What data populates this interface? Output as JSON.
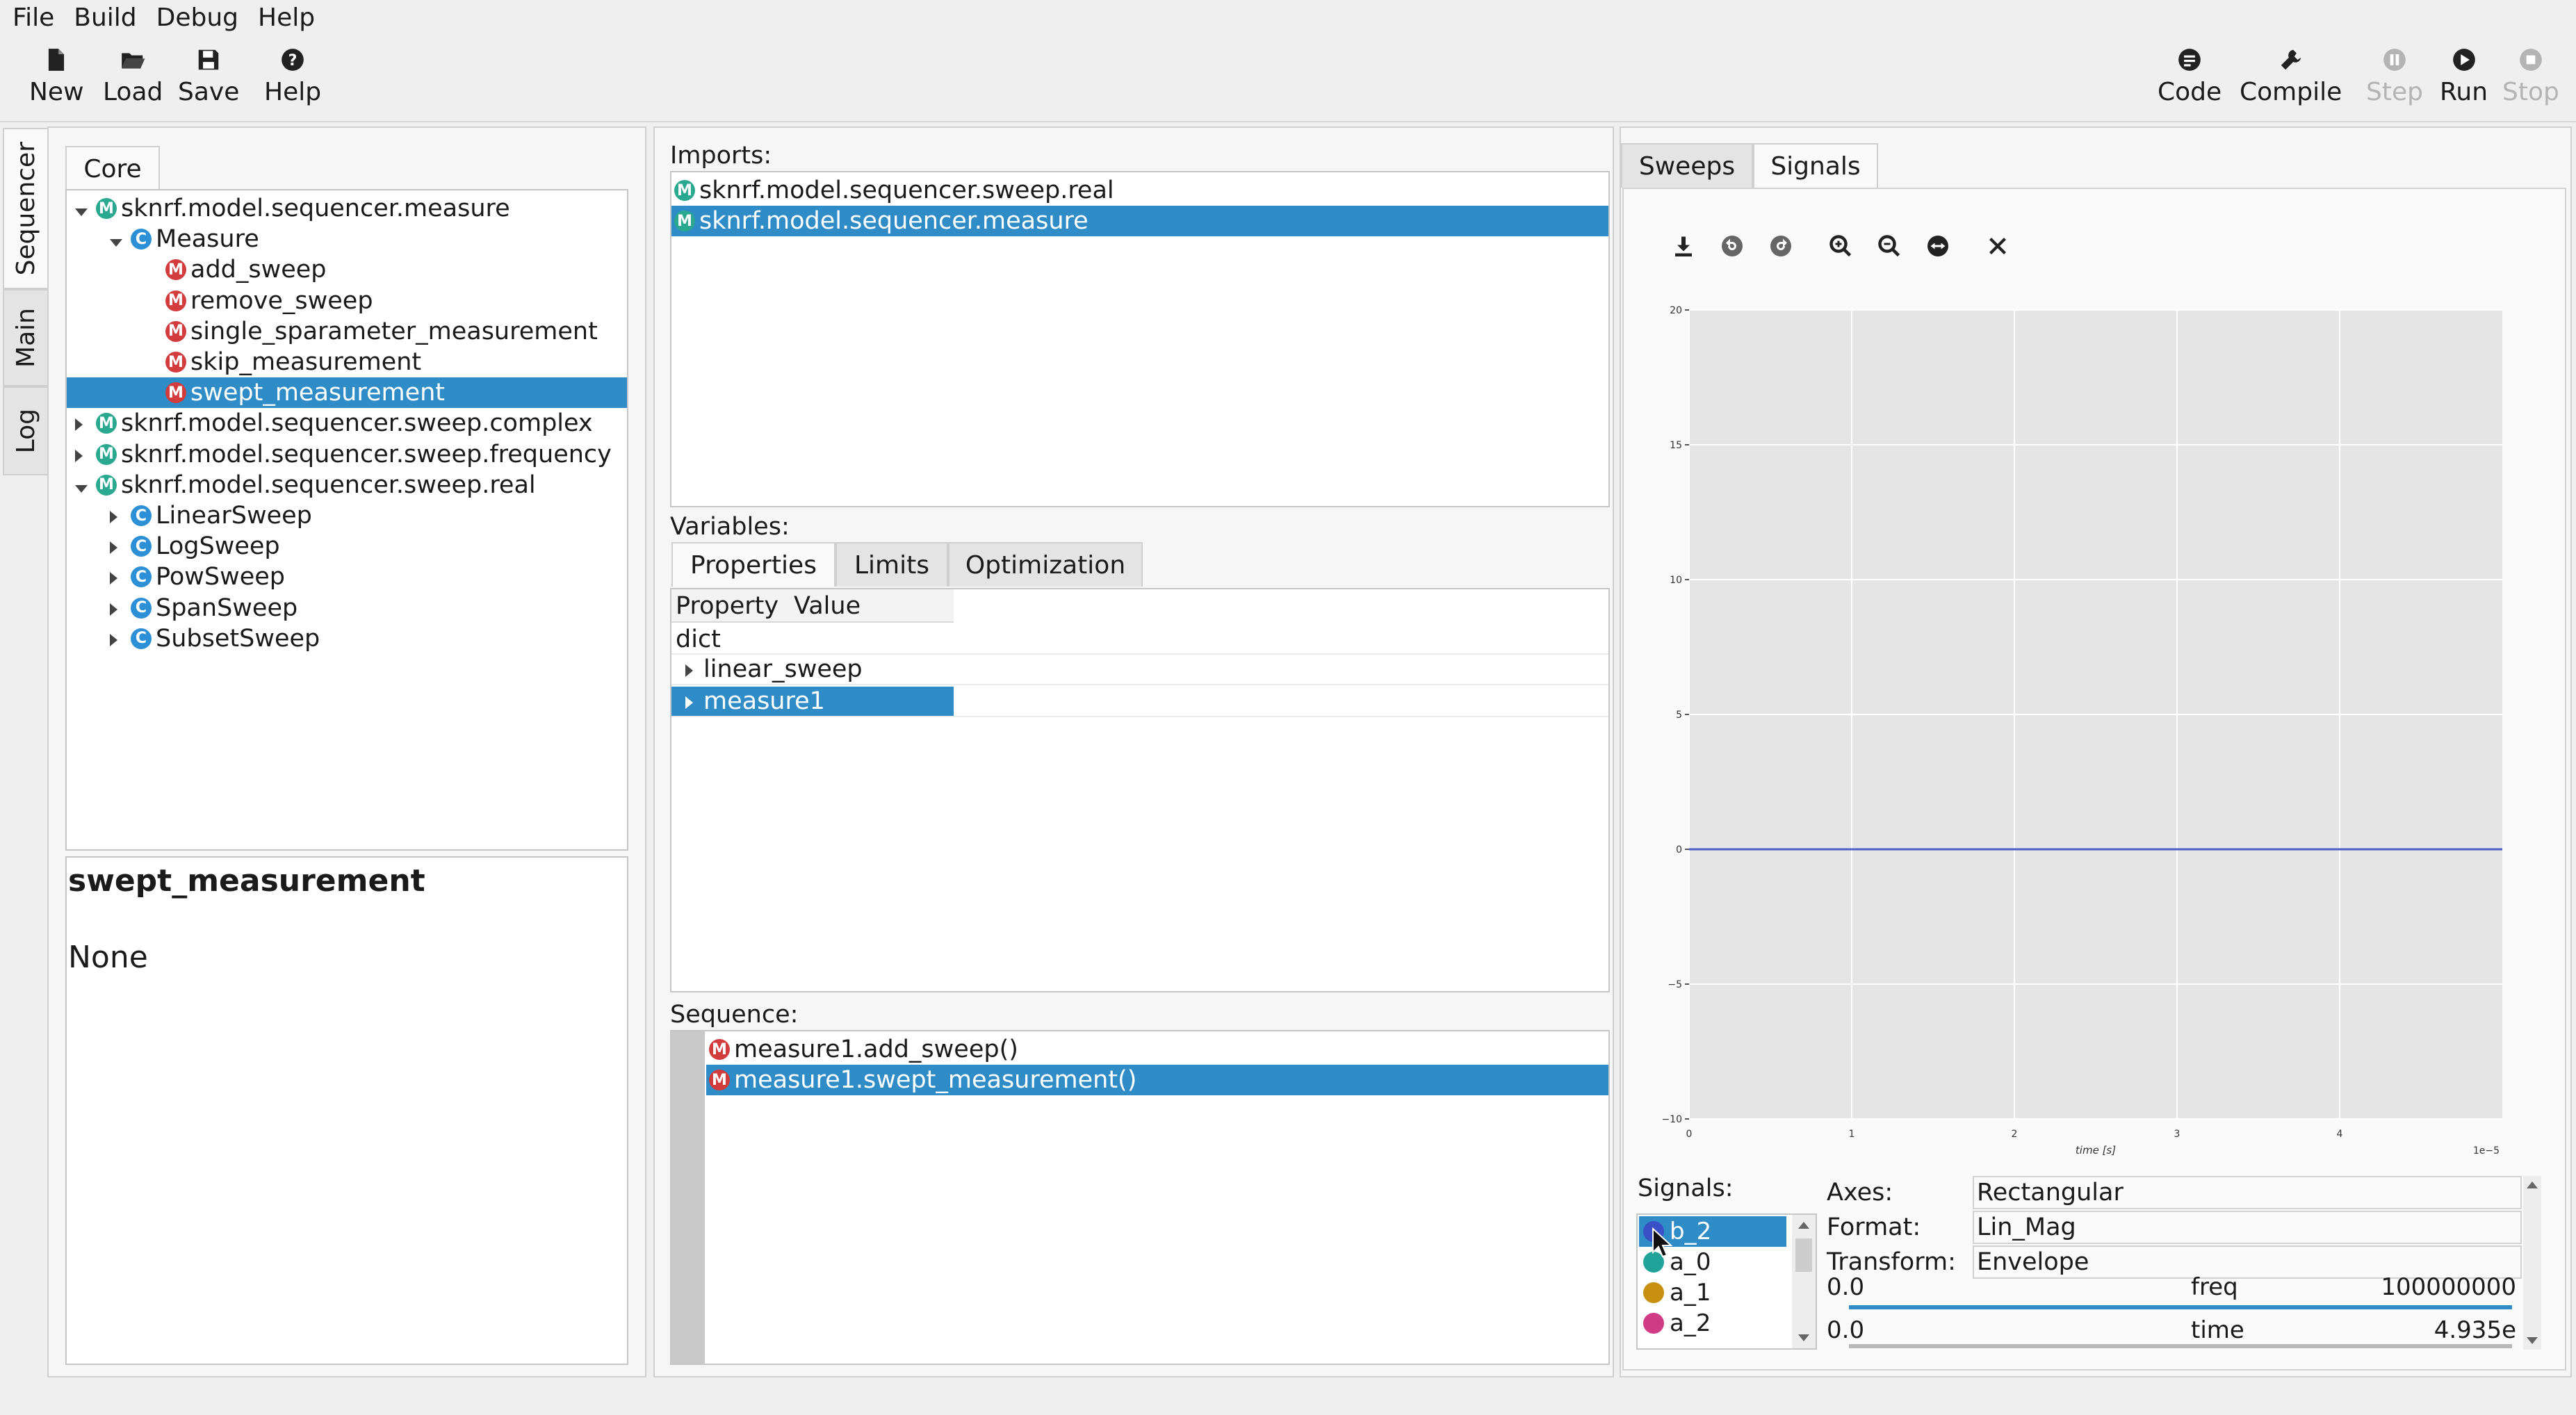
{
  "menu": [
    "File",
    "Build",
    "Debug",
    "Help"
  ],
  "toolbar": {
    "left": [
      {
        "label": "New",
        "icon": "new-file-icon"
      },
      {
        "label": "Load",
        "icon": "folder-open-icon"
      },
      {
        "label": "Save",
        "icon": "save-icon"
      },
      {
        "label": "Help",
        "icon": "help-icon"
      }
    ],
    "right": [
      {
        "label": "Code",
        "icon": "code-icon",
        "enabled": true
      },
      {
        "label": "Compile",
        "icon": "wrench-icon",
        "enabled": true
      },
      {
        "label": "Step",
        "icon": "step-icon",
        "enabled": false
      },
      {
        "label": "Run",
        "icon": "play-icon",
        "enabled": true
      },
      {
        "label": "Stop",
        "icon": "stop-icon",
        "enabled": false
      }
    ]
  },
  "side_tabs": [
    "Sequencer",
    "Main",
    "Log"
  ],
  "core": {
    "tab_label": "Core",
    "tree": [
      {
        "label": "sknrf.model.sequencer.measure",
        "type": "M",
        "expand": "down",
        "depth": 0
      },
      {
        "label": "Measure",
        "type": "C",
        "expand": "down",
        "depth": 1
      },
      {
        "label": "add_sweep",
        "type": "m",
        "expand": "none",
        "depth": 2
      },
      {
        "label": "remove_sweep",
        "type": "m",
        "expand": "none",
        "depth": 2
      },
      {
        "label": "single_sparameter_measurement",
        "type": "m",
        "expand": "none",
        "depth": 2
      },
      {
        "label": "skip_measurement",
        "type": "m",
        "expand": "none",
        "depth": 2
      },
      {
        "label": "swept_measurement",
        "type": "m",
        "expand": "none",
        "depth": 2,
        "selected": true
      },
      {
        "label": "sknrf.model.sequencer.sweep.complex",
        "type": "M",
        "expand": "right",
        "depth": 0
      },
      {
        "label": "sknrf.model.sequencer.sweep.frequency",
        "type": "M",
        "expand": "right",
        "depth": 0
      },
      {
        "label": "sknrf.model.sequencer.sweep.real",
        "type": "M",
        "expand": "down",
        "depth": 0
      },
      {
        "label": "LinearSweep",
        "type": "C",
        "expand": "right",
        "depth": 1
      },
      {
        "label": "LogSweep",
        "type": "C",
        "expand": "right",
        "depth": 1
      },
      {
        "label": "PowSweep",
        "type": "C",
        "expand": "right",
        "depth": 1
      },
      {
        "label": "SpanSweep",
        "type": "C",
        "expand": "right",
        "depth": 1
      },
      {
        "label": "SubsetSweep",
        "type": "C",
        "expand": "right",
        "depth": 1
      }
    ],
    "doc_title": "swept_measurement",
    "doc_body": "None"
  },
  "imports": {
    "label": "Imports:",
    "items": [
      {
        "label": "sknrf.model.sequencer.sweep.real",
        "selected": false
      },
      {
        "label": "sknrf.model.sequencer.measure",
        "selected": true
      }
    ]
  },
  "variables": {
    "label": "Variables:",
    "tabs": [
      "Properties",
      "Limits",
      "Optimization"
    ],
    "headers": [
      "Property",
      "Value"
    ],
    "root": "dict",
    "rows": [
      {
        "label": "linear_sweep",
        "selected": false
      },
      {
        "label": "measure1",
        "selected": true
      }
    ]
  },
  "sequence": {
    "label": "Sequence:",
    "items": [
      {
        "label": "measure1.add_sweep()",
        "selected": false
      },
      {
        "label": "measure1.swept_measurement()",
        "selected": true
      }
    ]
  },
  "right_tabs": [
    "Sweeps",
    "Signals"
  ],
  "plot_toolbar": [
    "download-icon",
    "undo-icon",
    "redo-icon",
    "zoom-in-icon",
    "zoom-out-icon",
    "pan-icon",
    "clear-icon"
  ],
  "chart_data": {
    "type": "line",
    "series": [
      {
        "values": [
          0,
          0
        ]
      }
    ],
    "x": [
      0,
      5
    ],
    "xlabel": "time [s]",
    "ylabel": "",
    "x_offset_label": "1e−5",
    "xlim": [
      0,
      5
    ],
    "ylim": [
      -10,
      20
    ],
    "xticks": [
      "0",
      "1",
      "2",
      "3",
      "4"
    ],
    "yticks": [
      "−10",
      "−5",
      "0",
      "5",
      "10",
      "15",
      "20"
    ],
    "grid": true,
    "line_color": "#4c5fc7"
  },
  "signals": {
    "label": "Signals:",
    "items": [
      {
        "label": "b_2",
        "color": "#3a50c6",
        "selected": true
      },
      {
        "label": "a_0",
        "color": "#21a39a",
        "selected": false
      },
      {
        "label": "a_1",
        "color": "#c8900e",
        "selected": false
      },
      {
        "label": "a_2",
        "color": "#d13b86",
        "selected": false
      }
    ],
    "props": [
      {
        "label": "Axes:",
        "value": "Rectangular"
      },
      {
        "label": "Format:",
        "value": "Lin_Mag"
      },
      {
        "label": "Transform:",
        "value": "Envelope"
      }
    ],
    "slider1": {
      "min": "0.0",
      "name": "freq",
      "max": "100000000"
    },
    "slider2": {
      "min": "0.0",
      "name": "time",
      "max": "4.935e"
    }
  }
}
